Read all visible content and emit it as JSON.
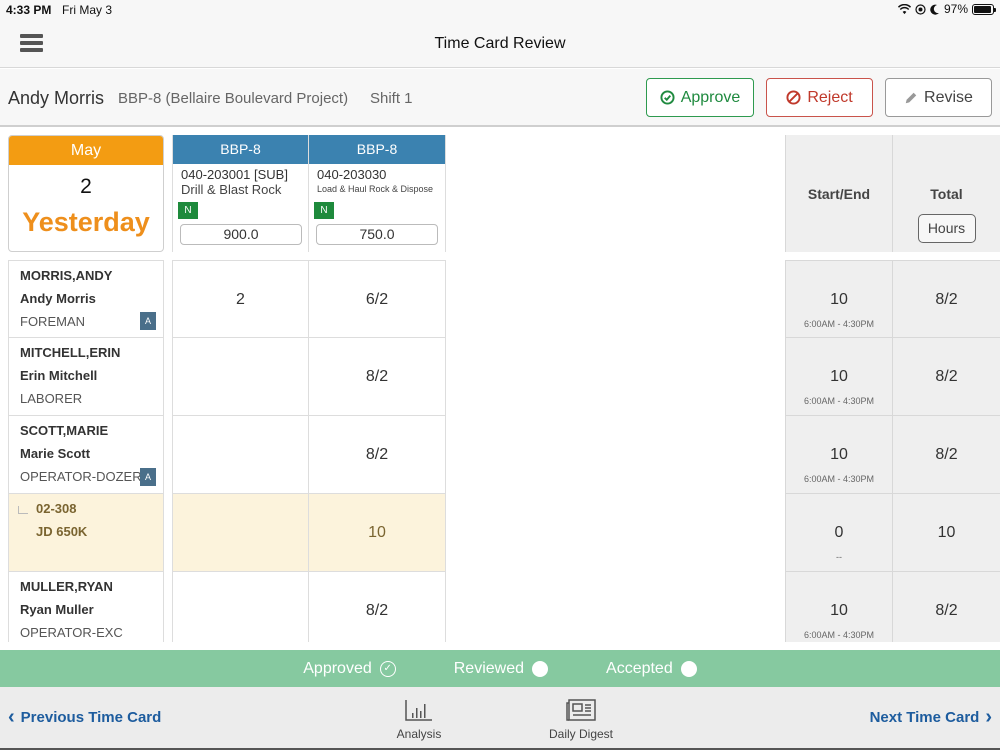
{
  "status_bar": {
    "time": "4:33 PM",
    "date": "Fri May 3",
    "battery": "97%"
  },
  "nav": {
    "title": "Time Card Review"
  },
  "header": {
    "employee": "Andy Morris",
    "project": "BBP-8 (Bellaire Boulevard Project)",
    "shift": "Shift 1",
    "approve_label": "Approve",
    "reject_label": "Reject",
    "revise_label": "Revise"
  },
  "date_card": {
    "month": "May",
    "day": "2",
    "relative": "Yesterday"
  },
  "cost_codes": [
    {
      "project": "BBP-8",
      "code": "040-203001 [SUB]",
      "description": "Drill & Blast Rock",
      "badge": "N",
      "quantity": "900.0"
    },
    {
      "project": "BBP-8",
      "code": "040-203030",
      "description": "Load & Haul Rock & Dispose",
      "badge": "N",
      "quantity": "750.0"
    }
  ],
  "summary_headers": {
    "start_end": "Start/End",
    "total": "Total",
    "hours_button": "Hours"
  },
  "rows": [
    {
      "type": "employee",
      "line1": "MORRIS,ANDY",
      "line2": "Andy Morris",
      "line3": "FOREMAN",
      "badge": "A",
      "hours": [
        "2",
        "6/2"
      ],
      "start_end": "10",
      "time_range": "6:00AM - 4:30PM",
      "total": "8/2"
    },
    {
      "type": "employee",
      "line1": "MITCHELL,ERIN",
      "line2": "Erin Mitchell",
      "line3": "LABORER",
      "badge": "",
      "hours": [
        "",
        "8/2"
      ],
      "start_end": "10",
      "time_range": "6:00AM - 4:30PM",
      "total": "8/2"
    },
    {
      "type": "employee",
      "line1": "SCOTT,MARIE",
      "line2": "Marie Scott",
      "line3": "OPERATOR-DOZER",
      "badge": "A",
      "hours": [
        "",
        "8/2"
      ],
      "start_end": "10",
      "time_range": "6:00AM - 4:30PM",
      "total": "8/2"
    },
    {
      "type": "equipment",
      "line1": "02-308",
      "line2": "JD 650K",
      "line3": "",
      "badge": "",
      "hours": [
        "",
        "10"
      ],
      "start_end": "0",
      "time_range": "--",
      "total": "10"
    },
    {
      "type": "employee",
      "line1": "MULLER,RYAN",
      "line2": "Ryan Muller",
      "line3": "OPERATOR-EXC",
      "badge": "",
      "hours": [
        "",
        "8/2"
      ],
      "start_end": "10",
      "time_range": "6:00AM - 4:30PM",
      "total": "8/2"
    }
  ],
  "status_strip": {
    "approved": "Approved",
    "reviewed": "Reviewed",
    "accepted": "Accepted"
  },
  "bottom_bar": {
    "previous": "Previous Time Card",
    "next": "Next Time Card",
    "analysis": "Analysis",
    "daily_digest": "Daily Digest"
  },
  "colors": {
    "date_header": "#f39c12",
    "project_header": "#3b82b0",
    "approve": "#1f8a3f",
    "reject": "#c0392b",
    "status_strip": "#86c9a0",
    "link": "#1d5c9e"
  }
}
